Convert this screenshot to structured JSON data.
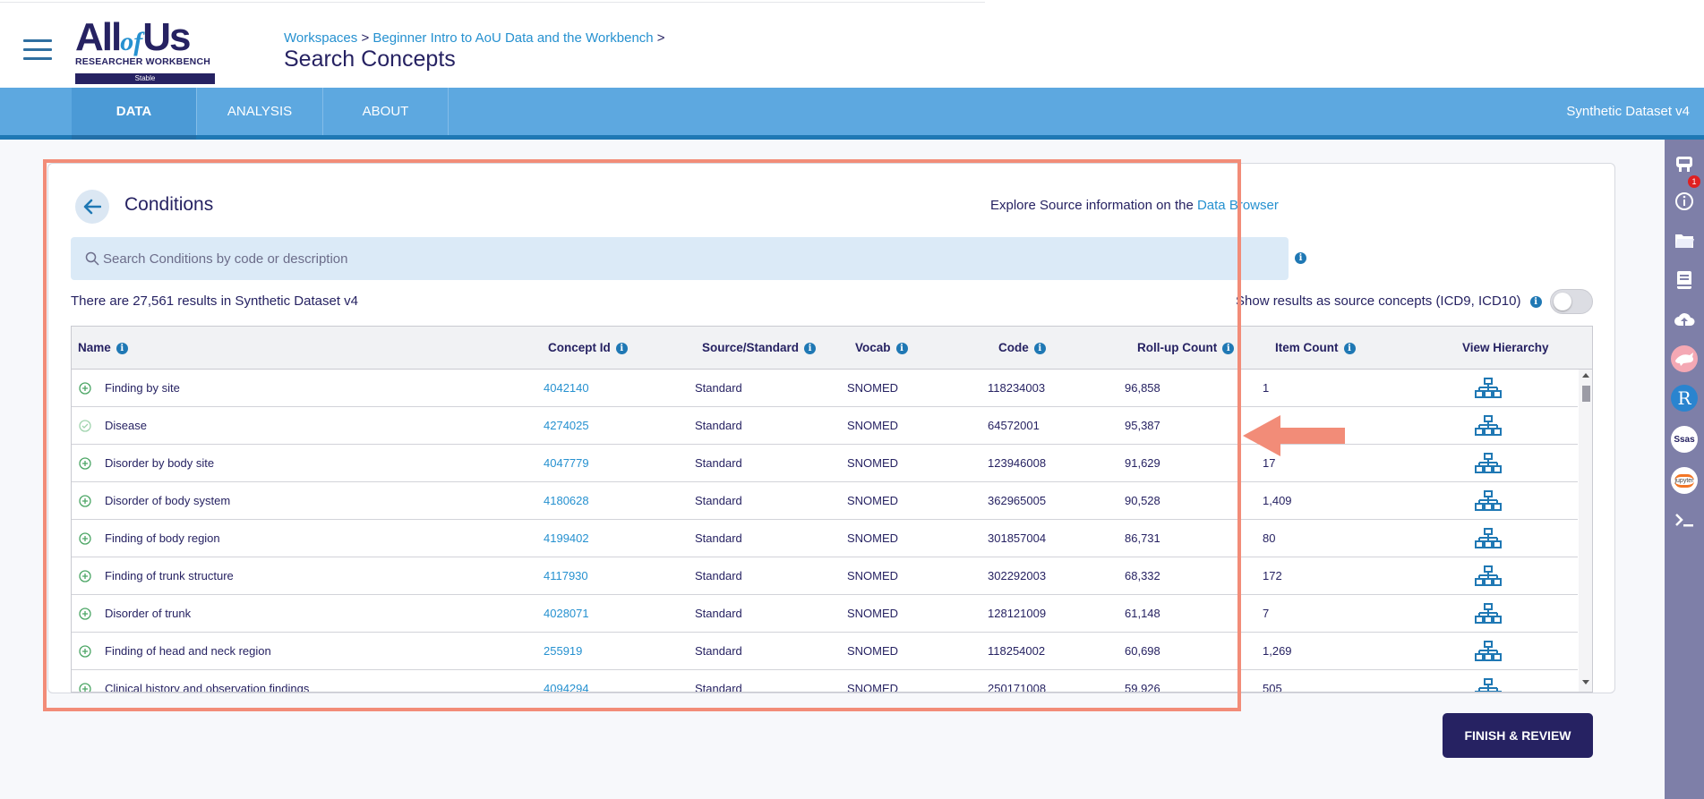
{
  "header": {
    "logo": {
      "word_all": "All",
      "word_of": "of",
      "word_us": "Us",
      "subtitle": "RESEARCHER WORKBENCH",
      "badge": "Stable"
    },
    "breadcrumb": {
      "items": [
        "Workspaces",
        "Beginner Intro to AoU Data and the Workbench"
      ],
      "separator": ">"
    },
    "page_title": "Search Concepts"
  },
  "nav": {
    "tabs": [
      {
        "label": "DATA",
        "active": true
      },
      {
        "label": "ANALYSIS",
        "active": false
      },
      {
        "label": "ABOUT",
        "active": false
      }
    ],
    "dataset": "Synthetic Dataset v4"
  },
  "right_rail": {
    "icons": [
      "criteria-cart-icon",
      "info-icon",
      "folder-icon",
      "notebook-icon",
      "cloud-upload-icon",
      "cromwell-icon",
      "rstudio-icon",
      "sas-icon",
      "jupyter-icon",
      "terminal-icon"
    ],
    "cart_count": "1",
    "rstudio_glyph": "R",
    "sas_glyph": "Ssas",
    "jupyter_glyph": "jupyter"
  },
  "card": {
    "title": "Conditions",
    "explore_text": "Explore Source information on the",
    "explore_link": "Data Browser",
    "search_placeholder": "Search Conditions by code or description",
    "results_text": "There are 27,561 results in Synthetic Dataset v4",
    "source_toggle_label": "Show results as source concepts (ICD9, ICD10)",
    "source_toggle_on": false
  },
  "table": {
    "columns": [
      "Name",
      "Concept Id",
      "Source/Standard",
      "Vocab",
      "Code",
      "Roll-up Count",
      "Item Count",
      "View Hierarchy"
    ],
    "rows": [
      {
        "name": "Finding by site",
        "concept_id": "4042140",
        "source": "Standard",
        "vocab": "SNOMED",
        "code": "118234003",
        "rollup": "96,858",
        "item": "1",
        "selected": false
      },
      {
        "name": "Disease",
        "concept_id": "4274025",
        "source": "Standard",
        "vocab": "SNOMED",
        "code": "64572001",
        "rollup": "95,387",
        "item": "",
        "selected": true
      },
      {
        "name": "Disorder by body site",
        "concept_id": "4047779",
        "source": "Standard",
        "vocab": "SNOMED",
        "code": "123946008",
        "rollup": "91,629",
        "item": "17",
        "selected": false
      },
      {
        "name": "Disorder of body system",
        "concept_id": "4180628",
        "source": "Standard",
        "vocab": "SNOMED",
        "code": "362965005",
        "rollup": "90,528",
        "item": "1,409",
        "selected": false
      },
      {
        "name": "Finding of body region",
        "concept_id": "4199402",
        "source": "Standard",
        "vocab": "SNOMED",
        "code": "301857004",
        "rollup": "86,731",
        "item": "80",
        "selected": false
      },
      {
        "name": "Finding of trunk structure",
        "concept_id": "4117930",
        "source": "Standard",
        "vocab": "SNOMED",
        "code": "302292003",
        "rollup": "68,332",
        "item": "172",
        "selected": false
      },
      {
        "name": "Disorder of trunk",
        "concept_id": "4028071",
        "source": "Standard",
        "vocab": "SNOMED",
        "code": "128121009",
        "rollup": "61,148",
        "item": "7",
        "selected": false
      },
      {
        "name": "Finding of head and neck region",
        "concept_id": "255919",
        "source": "Standard",
        "vocab": "SNOMED",
        "code": "118254002",
        "rollup": "60,698",
        "item": "1,269",
        "selected": false
      },
      {
        "name": "Clinical history and observation findings",
        "concept_id": "4094294",
        "source": "Standard",
        "vocab": "SNOMED",
        "code": "250171008",
        "rollup": "59,926",
        "item": "505",
        "selected": false
      }
    ]
  },
  "footer": {
    "finish_label": "FINISH & REVIEW"
  },
  "colors": {
    "brand_navy": "#262262",
    "brand_blue": "#2691d0",
    "nav_blue": "#5da8e0",
    "annotation": "#f28c78",
    "add_green": "#4aa564"
  }
}
